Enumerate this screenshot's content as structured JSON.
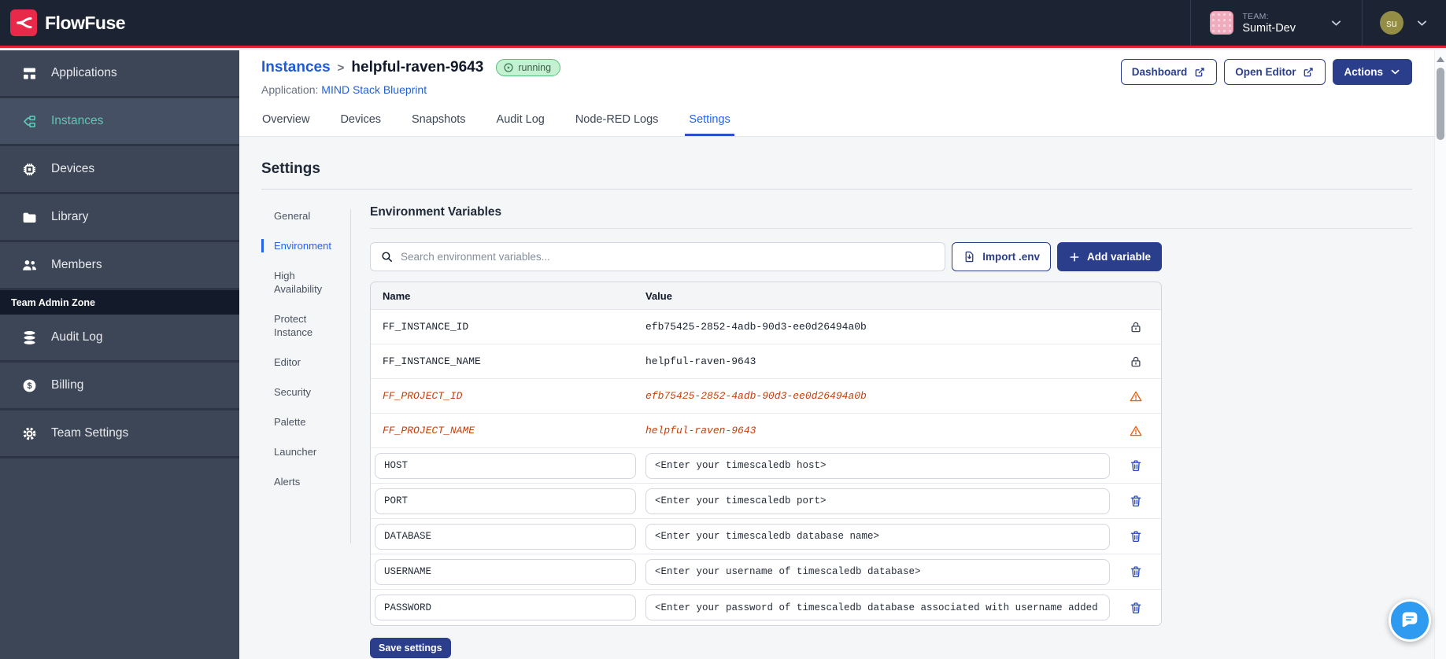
{
  "topbar": {
    "brand": "FlowFuse",
    "team_label": "TEAM:",
    "team_name": "Sumit-Dev",
    "user_initials": "su"
  },
  "sidebar": {
    "items": [
      {
        "label": "Applications"
      },
      {
        "label": "Instances"
      },
      {
        "label": "Devices"
      },
      {
        "label": "Library"
      },
      {
        "label": "Members"
      }
    ],
    "admin_zone_label": "Team Admin Zone",
    "admin_items": [
      {
        "label": "Audit Log"
      },
      {
        "label": "Billing"
      },
      {
        "label": "Team Settings"
      }
    ]
  },
  "header": {
    "breadcrumb_parent": "Instances",
    "breadcrumb_separator": ">",
    "instance_name": "helpful-raven-9643",
    "status": "running",
    "application_label": "Application:",
    "application_name": "MIND Stack Blueprint",
    "dashboard_label": "Dashboard",
    "open_editor_label": "Open Editor",
    "actions_label": "Actions"
  },
  "tabs": {
    "items": [
      "Overview",
      "Devices",
      "Snapshots",
      "Audit Log",
      "Node-RED Logs",
      "Settings"
    ],
    "active": "Settings"
  },
  "settings": {
    "title": "Settings",
    "nav": [
      "General",
      "Environment",
      "High Availability",
      "Protect Instance",
      "Editor",
      "Security",
      "Palette",
      "Launcher",
      "Alerts"
    ],
    "active": "Environment"
  },
  "env": {
    "title": "Environment Variables",
    "search_placeholder": "Search environment variables...",
    "import_label": "Import .env",
    "add_label": "Add variable",
    "columns": {
      "name": "Name",
      "value": "Value"
    },
    "rows": [
      {
        "name": "FF_INSTANCE_ID",
        "value": "efb75425-2852-4adb-90d3-ee0d26494a0b",
        "type": "locked"
      },
      {
        "name": "FF_INSTANCE_NAME",
        "value": "helpful-raven-9643",
        "type": "locked"
      },
      {
        "name": "FF_PROJECT_ID",
        "value": "efb75425-2852-4adb-90d3-ee0d26494a0b",
        "type": "deprecated"
      },
      {
        "name": "FF_PROJECT_NAME",
        "value": "helpful-raven-9643",
        "type": "deprecated"
      },
      {
        "name": "HOST",
        "value": "<Enter your timescaledb host>",
        "type": "editable"
      },
      {
        "name": "PORT",
        "value": "<Enter your timescaledb port>",
        "type": "editable"
      },
      {
        "name": "DATABASE",
        "value": "<Enter your timescaledb database name>",
        "type": "editable"
      },
      {
        "name": "USERNAME",
        "value": "<Enter your username of timescaledb database>",
        "type": "editable"
      },
      {
        "name": "PASSWORD",
        "value": "<Enter your password of timescaledb database associated with username added",
        "type": "editable"
      }
    ],
    "save_label": "Save settings"
  },
  "colors": {
    "brand_red": "#DE2439",
    "logo_red": "#E92949",
    "topbar_navy": "#1C2433",
    "sidebar_gray": "#3D4656",
    "accent_teal": "#5BC9B5",
    "primary_navy": "#2B3E8C",
    "link_blue": "#1D5BDB",
    "tab_active_blue": "#2563EB",
    "status_green_bg": "#C4F1D2",
    "status_green_border": "#5BBE78",
    "deprecated_orange": "#C2410C",
    "warning_orange": "#E8610C",
    "trash_blue": "#2B47B8",
    "chat_blue": "#2E9BF0"
  }
}
